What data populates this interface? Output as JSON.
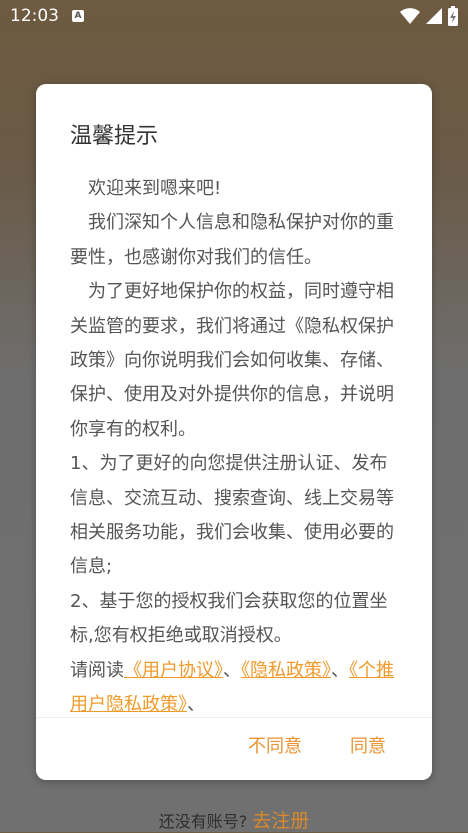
{
  "status_bar": {
    "time": "12:03",
    "notif_letter": "A"
  },
  "dialog": {
    "title": "温馨提示",
    "p1": "欢迎来到嗯来吧!",
    "p2": "我们深知个人信息和隐私保护对你的重要性，也感谢你对我们的信任。",
    "p3": "为了更好地保护你的权益，同时遵守相关监管的要求，我们将通过《隐私权保护政策》向你说明我们会如何收集、存储、保护、使用及对外提供你的信息，并说明你享有的权利。",
    "item1": "1、为了更好的向您提供注册认证、发布信息、交流互动、搜索查询、线上交易等相关服务功能，我们会收集、使用必要的信息;",
    "item2": "2、基于您的授权我们会获取您的位置坐标,您有权拒绝或取消授权。",
    "read_prefix": "请阅读",
    "link_user_agreement": "《用户协议》",
    "sep1": "、",
    "link_privacy_policy": "《隐私政策》",
    "sep2": "、",
    "link_getui_privacy": "《个推用户隐私政策》",
    "sep3": "、",
    "btn_disagree": "不同意",
    "btn_agree": "同意"
  },
  "footer": {
    "no_account": "还没有账号?",
    "register": "去注册"
  },
  "colors": {
    "accent": "#f09a2a",
    "title": "#333333",
    "body_text": "#555555"
  }
}
